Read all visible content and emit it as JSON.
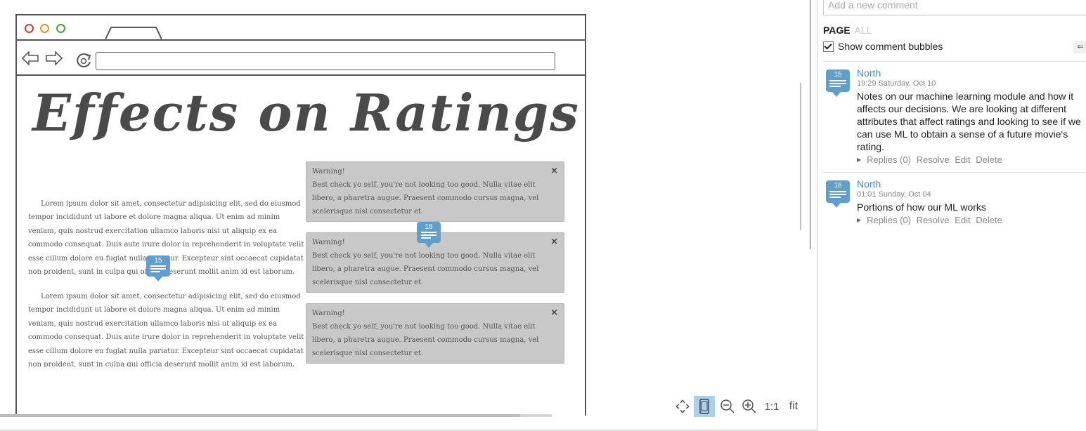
{
  "canvas": {
    "page_title": "Effects on Ratings",
    "paragraph": "Lorem ipsum dolor sit amet, consectetur adipisicing elit, sed do eiusmod tempor incididunt ut labore et dolore magna aliqua. Ut enim ad minim veniam, quis nostrud exercitation ullamco laboris nisi ut aliquip ex ea commodo consequat. Duis aute irure dolor in reprehenderit in voluptate velit esse cillum dolore eu fugiat nulla pariatur. Excepteur sint occaecat cupidatat non proident, sunt in culpa qui officia deserunt mollit anim id est laborum.",
    "warnings": [
      {
        "title": "Warning!",
        "text": "Best check yo self, you're not looking too good. Nulla vitae elit libero, a pharetra augue. Praesent commodo cursus magna, vel scelerisque nisl consectetur et.",
        "close": "×"
      },
      {
        "title": "Warning!",
        "text": "Best check yo self, you're not looking too good. Nulla vitae elit libero, a pharetra augue. Praesent commodo cursus magna, vel scelerisque nisl consectetur et.",
        "close": "×"
      },
      {
        "title": "Warning!",
        "text": "Best check yo self, you're not looking too good. Nulla vitae elit libero, a pharetra augue. Praesent commodo cursus magna, vel scelerisque nisl consectetur et.",
        "close": "×"
      }
    ],
    "bubbles": [
      "15",
      "16"
    ]
  },
  "zoom_controls": {
    "pan_icon": "pan-arrows-icon",
    "device_icon": "device-icon",
    "zoom_out_icon": "zoom-out-icon",
    "zoom_in_icon": "zoom-in-icon",
    "actual_size": "1:1",
    "fit": "fit"
  },
  "panel": {
    "comment_placeholder": "Add a new comment",
    "scope_page": "PAGE",
    "scope_all": "ALL",
    "show_bubbles_label": "Show comment bubbles",
    "show_bubbles_checked": true,
    "comments": [
      {
        "number": "15",
        "author": "North",
        "time": "19:29 Saturday, Oct 10",
        "text": "Notes on our machine learning module and how it affects our decisions. We are looking at different attributes that affect ratings and looking to see if we can use ML to obtain a sense of a future movie's rating.",
        "replies": "Replies (0)",
        "resolve": "Resolve",
        "edit": "Edit",
        "delete": "Delete"
      },
      {
        "number": "16",
        "author": "North",
        "time": "01:01 Sunday, Oct 04",
        "text": "Portions of how our ML works",
        "replies": "Replies (0)",
        "resolve": "Resolve",
        "edit": "Edit",
        "delete": "Delete"
      }
    ]
  },
  "colors": {
    "bubble": "#5f9fcf",
    "author": "#3b8fd0",
    "warning_bg": "#c8c8c8",
    "active_control": "#a8d1ef"
  }
}
